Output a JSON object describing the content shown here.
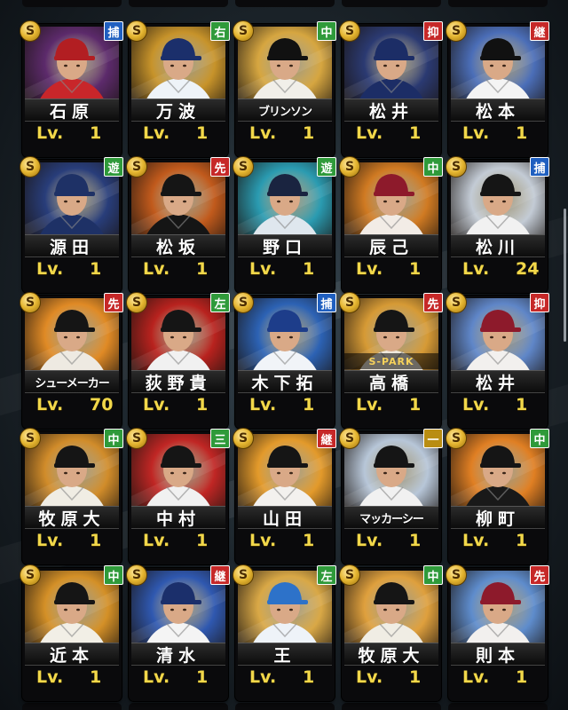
{
  "badge_symbol": "S",
  "level_prefix": "Lv.",
  "position_colors": {
    "捕": "#1f5fc0",
    "右": "#2f9a3a",
    "中": "#2f9a3a",
    "抑": "#c62828",
    "継": "#c62828",
    "遊": "#2f9a3a",
    "先": "#c62828",
    "左": "#2f9a3a",
    "三": "#2f9a3a",
    "一": "#b98d12"
  },
  "cards": [
    {
      "name": "石原",
      "position": "捕",
      "level": "1",
      "bg": "#5c2a6b",
      "uniform": "#c8262a",
      "cap": "#b21e22"
    },
    {
      "name": "万波",
      "position": "右",
      "level": "1",
      "bg": "#c7932a",
      "uniform": "#eef3f8",
      "cap": "#1b2f6b"
    },
    {
      "name": "ブリンソン",
      "position": "中",
      "level": "1",
      "bg": "#d6a640",
      "uniform": "#f1efe9",
      "cap": "#111111"
    },
    {
      "name": "松井",
      "position": "抑",
      "level": "1",
      "bg": "#2b3a72",
      "uniform": "#1c2d66",
      "cap": "#1c2d66"
    },
    {
      "name": "松本",
      "position": "継",
      "level": "1",
      "bg": "#4b6eb8",
      "uniform": "#f4f4f4",
      "cap": "#111111"
    },
    {
      "name": "源田",
      "position": "遊",
      "level": "1",
      "bg": "#283d7a",
      "uniform": "#1e3166",
      "cap": "#1e3166"
    },
    {
      "name": "松坂",
      "position": "先",
      "level": "1",
      "bg": "#c15a1c",
      "uniform": "#151515",
      "cap": "#151515"
    },
    {
      "name": "野口",
      "position": "遊",
      "level": "1",
      "bg": "#2a9bb1",
      "uniform": "#dfe7ee",
      "cap": "#1a2440"
    },
    {
      "name": "辰己",
      "position": "中",
      "level": "1",
      "bg": "#d07a22",
      "uniform": "#f2ece6",
      "cap": "#8d1a2b"
    },
    {
      "name": "松川",
      "position": "捕",
      "level": "24",
      "bg": "#c3cbd5",
      "uniform": "#f1f1f1",
      "cap": "#151515"
    },
    {
      "name": "シューメーカー",
      "position": "先",
      "level": "70",
      "bg": "#e08a25",
      "uniform": "#eeeae2",
      "cap": "#151515"
    },
    {
      "name": "荻野貴",
      "position": "左",
      "level": "1",
      "bg": "#b8221e",
      "uniform": "#f1f1f1",
      "cap": "#151515"
    },
    {
      "name": "木下拓",
      "position": "捕",
      "level": "1",
      "bg": "#2c62b4",
      "uniform": "#f1f4f8",
      "cap": "#1d3d8a"
    },
    {
      "name": "高橋",
      "position": "先",
      "level": "1",
      "bg": "#d69a35",
      "uniform": "#efe8dc",
      "cap": "#151515",
      "spark": "S-PARK"
    },
    {
      "name": "松井",
      "position": "抑",
      "level": "1",
      "bg": "#5f86c8",
      "uniform": "#f2f0ee",
      "cap": "#8d1a2b"
    },
    {
      "name": "牧原大",
      "position": "中",
      "level": "1",
      "bg": "#d18c2a",
      "uniform": "#f0ede4",
      "cap": "#151515"
    },
    {
      "name": "中村",
      "position": "三",
      "level": "1",
      "bg": "#c02624",
      "uniform": "#f1f1f1",
      "cap": "#151515"
    },
    {
      "name": "山田",
      "position": "継",
      "level": "1",
      "bg": "#e39a2b",
      "uniform": "#f3f1ee",
      "cap": "#151515"
    },
    {
      "name": "マッカーシー",
      "position": "一",
      "level": "1",
      "bg": "#b7c6d8",
      "uniform": "#f1f1f1",
      "cap": "#151515"
    },
    {
      "name": "柳町",
      "position": "中",
      "level": "1",
      "bg": "#e07f23",
      "uniform": "#191919",
      "cap": "#151515"
    },
    {
      "name": "近本",
      "position": "中",
      "level": "1",
      "bg": "#d49027",
      "uniform": "#f2efe6",
      "cap": "#151515"
    },
    {
      "name": "清水",
      "position": "継",
      "level": "1",
      "bg": "#2f58b0",
      "uniform": "#f4f4f4",
      "cap": "#1b2f6b"
    },
    {
      "name": "王",
      "position": "左",
      "level": "1",
      "bg": "#d9a846",
      "uniform": "#eef3f8",
      "cap": "#2d72c9"
    },
    {
      "name": "牧原大",
      "position": "中",
      "level": "1",
      "bg": "#dfa03d",
      "uniform": "#f0ede4",
      "cap": "#151515"
    },
    {
      "name": "則本",
      "position": "先",
      "level": "1",
      "bg": "#5e8ccc",
      "uniform": "#f2f0ee",
      "cap": "#8d1a2b"
    }
  ]
}
